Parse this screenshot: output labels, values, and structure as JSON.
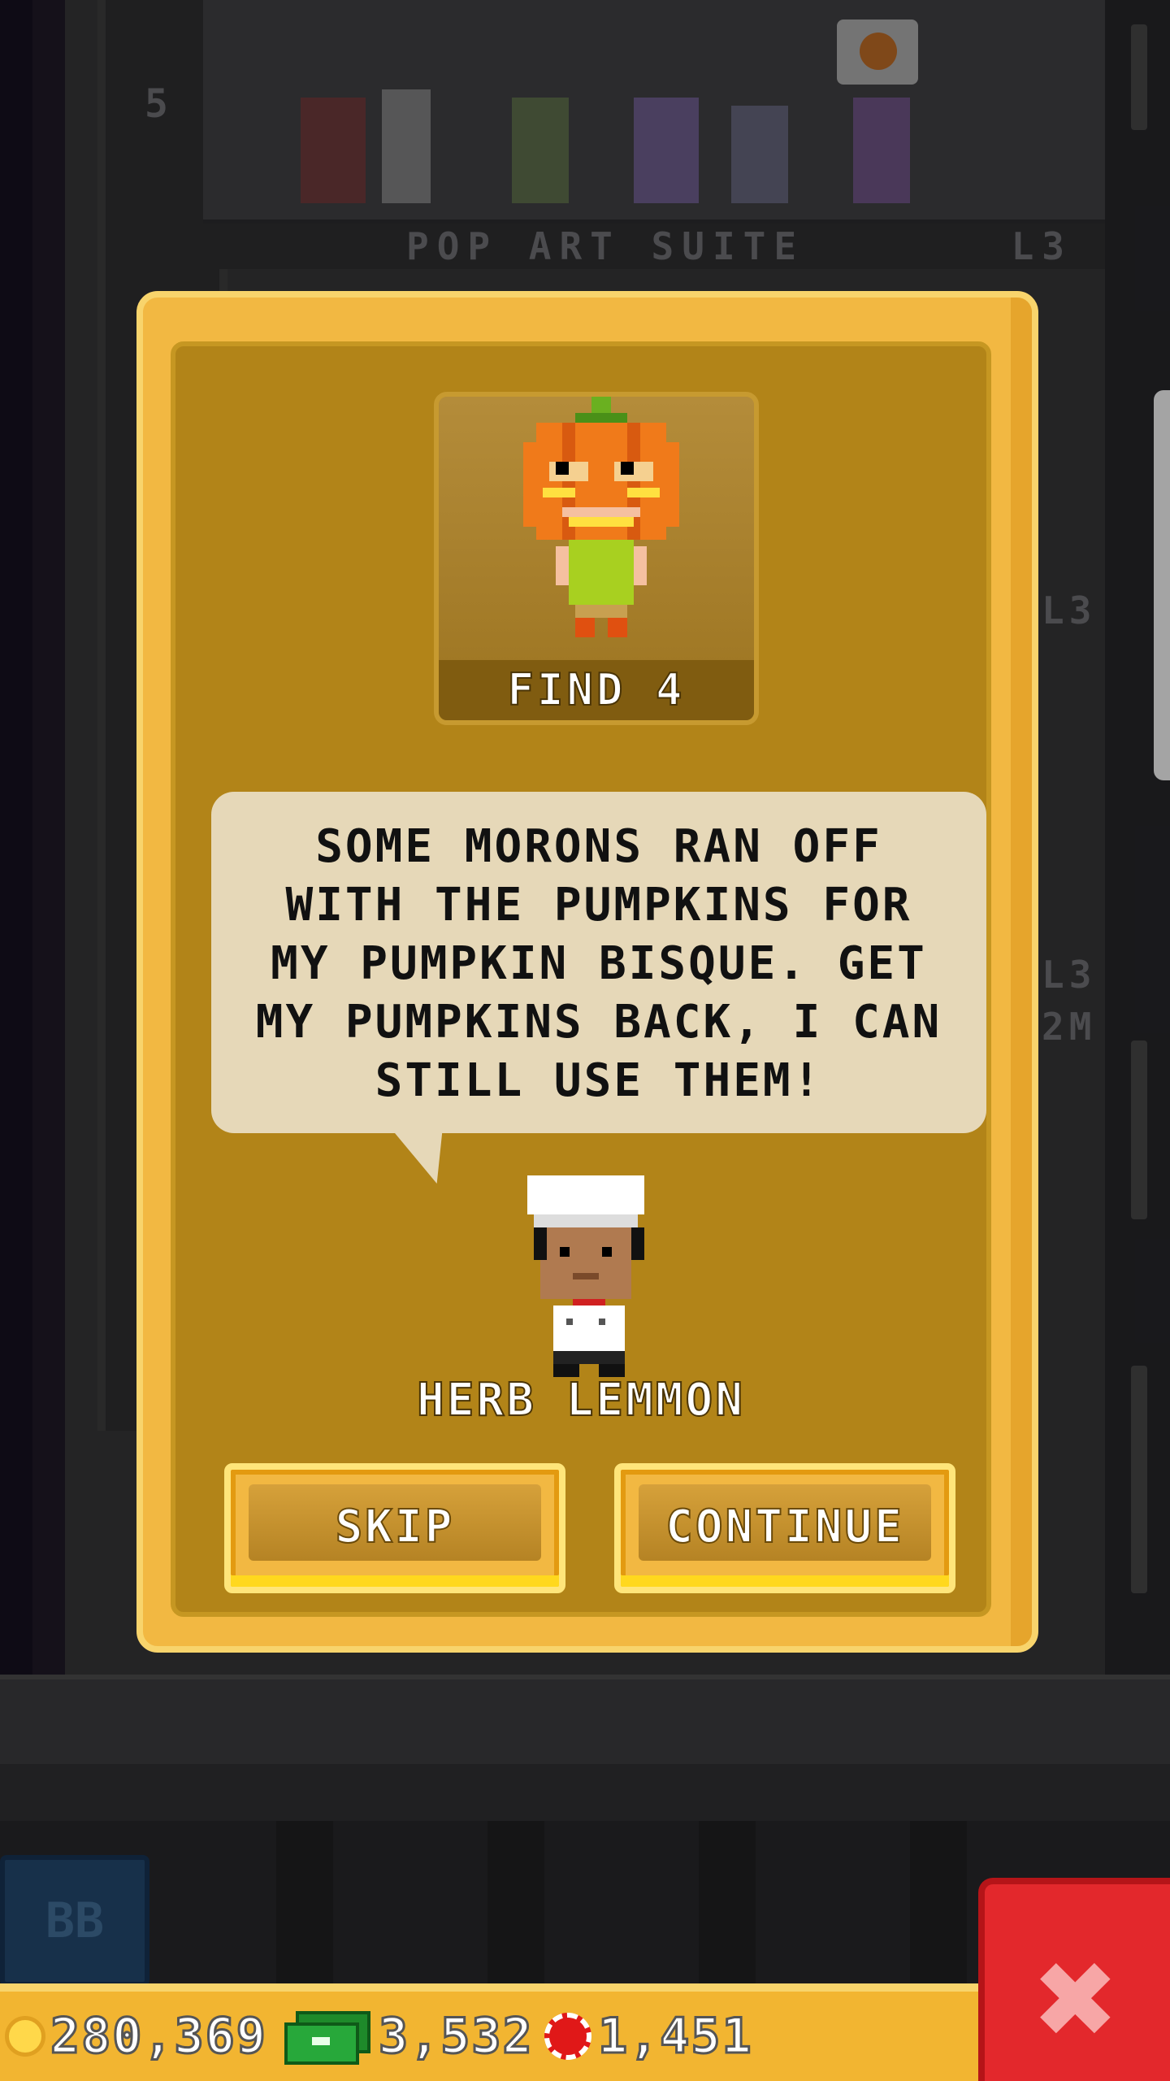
{
  "background": {
    "floor_name": "POP ART SUITE",
    "floor_number": "5",
    "level_tags": [
      "L3",
      "L3",
      "L3",
      "L3"
    ],
    "partial_tag": "2M"
  },
  "quest": {
    "find_label": "FIND 4",
    "target_icon": "pumpkin-head-character-icon",
    "message": "SOME MORONS RAN OFF\nWITH THE PUMPKINS FOR\nMY PUMPKIN BISQUE. GET\nMY PUMPKINS BACK, I CAN\nSTILL USE THEM!",
    "npc_name": "HERB LEMMON",
    "npc_icon": "chef-character-icon",
    "skip_label": "SKIP",
    "continue_label": "CONTINUE"
  },
  "lobby": {
    "bb_label": "BB"
  },
  "status_bar": {
    "coins": "280,369",
    "bux": "3,532",
    "tokens": "1,451"
  },
  "colors": {
    "modal_frame": "#f2b842",
    "modal_inner": "#b28418",
    "bubble": "#e6d8b8",
    "close_button": "#e3282c"
  }
}
